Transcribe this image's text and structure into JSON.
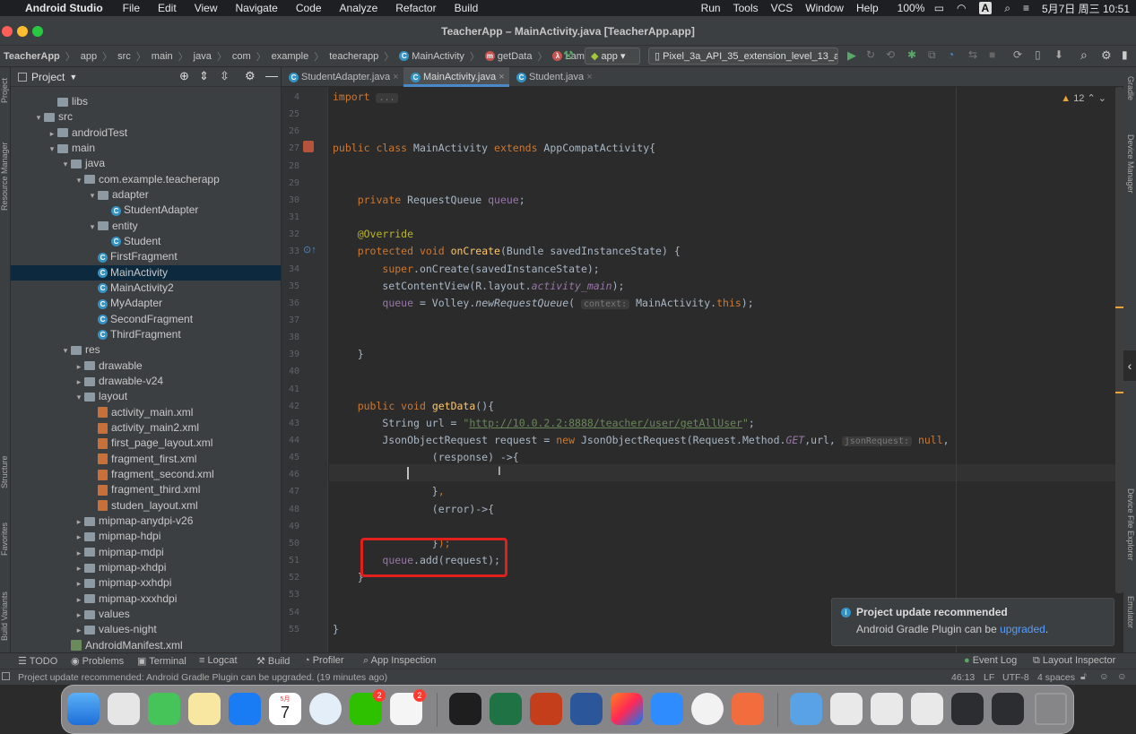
{
  "menubar": {
    "apple": "",
    "app": "Android Studio",
    "items": [
      "File",
      "Edit",
      "View",
      "Navigate",
      "Code",
      "Analyze",
      "Refactor",
      "Build",
      "Run",
      "Tools",
      "VCS",
      "Window",
      "Help"
    ],
    "battery": "100%",
    "input": "A",
    "datetime": "5月7日 周三  10:51"
  },
  "window": {
    "title": "TeacherApp – MainActivity.java [TeacherApp.app]"
  },
  "breadcrumbs": [
    "TeacherApp",
    "app",
    "src",
    "main",
    "java",
    "com",
    "example",
    "teacherapp",
    "MainActivity",
    "getData",
    "Lambda"
  ],
  "run_config": {
    "module": "app",
    "device": "Pixel_3a_API_35_extension_level_13_ar"
  },
  "project_panel": {
    "title": "Project"
  },
  "tree": [
    {
      "label": "libs",
      "type": "folder",
      "indent": 4,
      "arrow": ""
    },
    {
      "label": "src",
      "type": "folder",
      "indent": 3,
      "arrow": "▾"
    },
    {
      "label": "androidTest",
      "type": "folder",
      "indent": 4,
      "arrow": "▸"
    },
    {
      "label": "main",
      "type": "folder",
      "indent": 4,
      "arrow": "▾"
    },
    {
      "label": "java",
      "type": "folder",
      "indent": 5,
      "arrow": "▾"
    },
    {
      "label": "com.example.teacherapp",
      "type": "folder",
      "indent": 6,
      "arrow": "▾"
    },
    {
      "label": "adapter",
      "type": "folder",
      "indent": 7,
      "arrow": "▾"
    },
    {
      "label": "StudentAdapter",
      "type": "class",
      "indent": 8,
      "arrow": ""
    },
    {
      "label": "entity",
      "type": "folder",
      "indent": 7,
      "arrow": "▾"
    },
    {
      "label": "Student",
      "type": "class",
      "indent": 8,
      "arrow": ""
    },
    {
      "label": "FirstFragment",
      "type": "class",
      "indent": 7,
      "arrow": ""
    },
    {
      "label": "MainActivity",
      "type": "class",
      "indent": 7,
      "arrow": "",
      "selected": true
    },
    {
      "label": "MainActivity2",
      "type": "class",
      "indent": 7,
      "arrow": ""
    },
    {
      "label": "MyAdapter",
      "type": "class",
      "indent": 7,
      "arrow": ""
    },
    {
      "label": "SecondFragment",
      "type": "class",
      "indent": 7,
      "arrow": ""
    },
    {
      "label": "ThirdFragment",
      "type": "class",
      "indent": 7,
      "arrow": ""
    },
    {
      "label": "res",
      "type": "folder",
      "indent": 5,
      "arrow": "▾"
    },
    {
      "label": "drawable",
      "type": "folder",
      "indent": 6,
      "arrow": "▸"
    },
    {
      "label": "drawable-v24",
      "type": "folder",
      "indent": 6,
      "arrow": "▸"
    },
    {
      "label": "layout",
      "type": "folder",
      "indent": 6,
      "arrow": "▾"
    },
    {
      "label": "activity_main.xml",
      "type": "xml",
      "indent": 7,
      "arrow": ""
    },
    {
      "label": "activity_main2.xml",
      "type": "xml",
      "indent": 7,
      "arrow": ""
    },
    {
      "label": "first_page_layout.xml",
      "type": "xml",
      "indent": 7,
      "arrow": ""
    },
    {
      "label": "fragment_first.xml",
      "type": "xml",
      "indent": 7,
      "arrow": ""
    },
    {
      "label": "fragment_second.xml",
      "type": "xml",
      "indent": 7,
      "arrow": ""
    },
    {
      "label": "fragment_third.xml",
      "type": "xml",
      "indent": 7,
      "arrow": ""
    },
    {
      "label": "studen_layout.xml",
      "type": "xml",
      "indent": 7,
      "arrow": ""
    },
    {
      "label": "mipmap-anydpi-v26",
      "type": "folder",
      "indent": 6,
      "arrow": "▸"
    },
    {
      "label": "mipmap-hdpi",
      "type": "folder",
      "indent": 6,
      "arrow": "▸"
    },
    {
      "label": "mipmap-mdpi",
      "type": "folder",
      "indent": 6,
      "arrow": "▸"
    },
    {
      "label": "mipmap-xhdpi",
      "type": "folder",
      "indent": 6,
      "arrow": "▸"
    },
    {
      "label": "mipmap-xxhdpi",
      "type": "folder",
      "indent": 6,
      "arrow": "▸"
    },
    {
      "label": "mipmap-xxxhdpi",
      "type": "folder",
      "indent": 6,
      "arrow": "▸"
    },
    {
      "label": "values",
      "type": "folder",
      "indent": 6,
      "arrow": "▸"
    },
    {
      "label": "values-night",
      "type": "folder",
      "indent": 6,
      "arrow": "▸"
    },
    {
      "label": "AndroidManifest.xml",
      "type": "manifest",
      "indent": 5,
      "arrow": ""
    }
  ],
  "tabs": [
    {
      "label": "StudentAdapter.java",
      "active": false
    },
    {
      "label": "MainActivity.java",
      "active": true
    },
    {
      "label": "Student.java",
      "active": false
    }
  ],
  "editor": {
    "warnings": "12",
    "lines": [
      {
        "n": "4",
        "html": "<span class=\"kw\">import</span> <span class=\"hint\">...</span>"
      },
      {
        "n": "25",
        "html": ""
      },
      {
        "n": "26",
        "html": ""
      },
      {
        "n": "27",
        "html": "<span class=\"kw\">public class</span> MainActivity <span class=\"kw\">extends</span> AppCompatActivity{"
      },
      {
        "n": "28",
        "html": ""
      },
      {
        "n": "29",
        "html": ""
      },
      {
        "n": "30",
        "html": "    <span class=\"kw\">private</span> RequestQueue <span class=\"fld\">queue</span>;"
      },
      {
        "n": "31",
        "html": ""
      },
      {
        "n": "32",
        "html": "    <span class=\"ann\">@Override</span>"
      },
      {
        "n": "33",
        "html": "    <span class=\"kw\">protected void</span> <span class=\"fn\">onCreate</span>(Bundle savedInstanceState) {"
      },
      {
        "n": "34",
        "html": "        <span class=\"kw\">super</span>.onCreate(savedInstanceState);"
      },
      {
        "n": "35",
        "html": "        setContentView(R.layout.<span class=\"fld ital\">activity_main</span>);"
      },
      {
        "n": "36",
        "html": "        <span class=\"fld\">queue</span> = Volley.<span class=\"ital\">newRequestQueue</span>( <span class=\"hint\">context:</span> MainActivity.<span class=\"kw\">this</span>);"
      },
      {
        "n": "37",
        "html": ""
      },
      {
        "n": "38",
        "html": ""
      },
      {
        "n": "39",
        "html": "    }"
      },
      {
        "n": "40",
        "html": ""
      },
      {
        "n": "41",
        "html": ""
      },
      {
        "n": "42",
        "html": "    <span class=\"kw\">public void</span> <span class=\"fn\">getData</span>(){"
      },
      {
        "n": "43",
        "html": "        String url = <span class=\"str\">\"</span><span class=\"url\">http://10.0.2.2:8888/teacher/user/getAllUser</span><span class=\"str\">\"</span>;"
      },
      {
        "n": "44",
        "html": "        JsonObjectRequest request = <span class=\"kw\">new</span> JsonObjectRequest(Request.Method.<span class=\"fld ital\">GET</span>,url, <span class=\"hint\">jsonRequest:</span> <span class=\"kw\">null</span>,"
      },
      {
        "n": "45",
        "html": "                (response) ->{"
      },
      {
        "n": "46",
        "html": ""
      },
      {
        "n": "47",
        "html": "                }<span class=\"kw\">,</span>"
      },
      {
        "n": "48",
        "html": "                (error)->{"
      },
      {
        "n": "49",
        "html": ""
      },
      {
        "n": "50",
        "html": "                }<span class=\"kw\">);</span>"
      },
      {
        "n": "51",
        "html": "        <span class=\"fld\">queue</span>.add(request);"
      },
      {
        "n": "52",
        "html": "    }"
      },
      {
        "n": "53",
        "html": ""
      },
      {
        "n": "54",
        "html": ""
      },
      {
        "n": "55",
        "html": "}"
      }
    ]
  },
  "notification": {
    "title": "Project update recommended",
    "body": "Android Gradle Plugin can be ",
    "link": "upgraded",
    "end": "."
  },
  "bottom_tools": [
    "TODO",
    "Problems",
    "Terminal",
    "Logcat",
    "Build",
    "Profiler",
    "App Inspection",
    "Event Log",
    "Layout Inspector"
  ],
  "status": {
    "message": "Project update recommended: Android Gradle Plugin can be upgraded. (19 minutes ago)",
    "position": "46:13",
    "lf": "LF",
    "encoding": "UTF-8",
    "indent": "4 spaces"
  },
  "side_labels": {
    "left": [
      "Project",
      "Resource Manager",
      "Structure",
      "Favorites",
      "Build Variants"
    ],
    "right": [
      "Gradle",
      "Device Manager",
      "Device File Explorer",
      "Emulator"
    ]
  },
  "dock": {
    "calendar_month": "5月",
    "calendar_day": "7",
    "wechat_badge": "2",
    "qq_badge": "2"
  }
}
